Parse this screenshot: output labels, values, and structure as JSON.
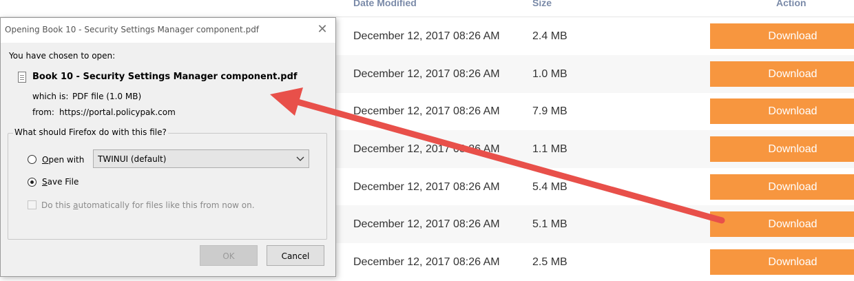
{
  "table": {
    "headers": {
      "date": "Date Modified",
      "size": "Size",
      "action": "Action"
    },
    "rows": [
      {
        "date": "December 12, 2017 08:26 AM",
        "size": "2.4 MB",
        "action": "Download"
      },
      {
        "date": "December 12, 2017 08:26 AM",
        "size": "1.0 MB",
        "action": "Download"
      },
      {
        "date": "December 12, 2017 08:26 AM",
        "size": "7.9 MB",
        "action": "Download"
      },
      {
        "date": "December 12, 2017 08:26 AM",
        "size": "1.1 MB",
        "action": "Download"
      },
      {
        "date": "December 12, 2017 08:26 AM",
        "size": "5.4 MB",
        "action": "Download"
      },
      {
        "date": "December 12, 2017 08:26 AM",
        "size": "5.1 MB",
        "action": "Download"
      },
      {
        "date": "December 12, 2017 08:26 AM",
        "size": "2.5 MB",
        "action": "Download"
      }
    ]
  },
  "dialog": {
    "title": "Opening Book 10 - Security Settings Manager component.pdf",
    "intro": "You have chosen to open:",
    "filename": "Book 10 - Security Settings Manager component.pdf",
    "which_label": "which is:",
    "which_value": "PDF file (1.0 MB)",
    "from_label": "from:",
    "from_value": "https://portal.policypak.com",
    "question": "What should Firefox do with this file?",
    "open_with_accel": "O",
    "open_with_rest": "pen with",
    "open_with_app": "TWINUI (default)",
    "save_accel": "S",
    "save_rest": "ave File",
    "auto_pre": "Do this ",
    "auto_accel": "a",
    "auto_rest": "utomatically for files like this from now on.",
    "ok_label": "OK",
    "cancel_label": "Cancel"
  },
  "colors": {
    "download_button": "#f7963f",
    "annotation_arrow": "#e8504a"
  }
}
